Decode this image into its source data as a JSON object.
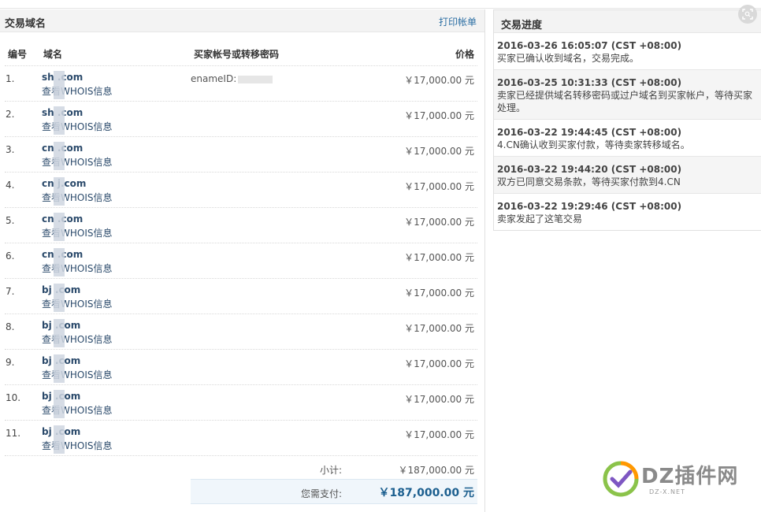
{
  "domains_panel": {
    "title": "交易域名",
    "print_label": "打印帐单",
    "headers": {
      "no": "编号",
      "domain": "域名",
      "code": "买家帐号或转移密码",
      "price": "价格"
    },
    "rows": [
      {
        "no": "1.",
        "domain": "sh   .com",
        "whois": "查看WHOIS信息",
        "code": "enameID:",
        "price": "￥17,000.00 元"
      },
      {
        "no": "2.",
        "domain": "sh   .com",
        "whois": "查看WHOIS信息",
        "code": "",
        "price": "￥17,000.00 元"
      },
      {
        "no": "3.",
        "domain": "cn   .com",
        "whois": "查看WHOIS信息",
        "code": "",
        "price": "￥17,000.00 元"
      },
      {
        "no": "4.",
        "domain": "cn   j.com",
        "whois": "查看WHOIS信息",
        "code": "",
        "price": "￥17,000.00 元"
      },
      {
        "no": "5.",
        "domain": "cn   .com",
        "whois": "查看WHOIS信息",
        "code": "",
        "price": "￥17,000.00 元"
      },
      {
        "no": "6.",
        "domain": "cn   .com",
        "whois": "查看WHOIS信息",
        "code": "",
        "price": "￥17,000.00 元"
      },
      {
        "no": "7.",
        "domain": "bj   .com",
        "whois": "查看WHOIS信息",
        "code": "",
        "price": "￥17,000.00 元"
      },
      {
        "no": "8.",
        "domain": "bj   .com",
        "whois": "查看WHOIS信息",
        "code": "",
        "price": "￥17,000.00 元"
      },
      {
        "no": "9.",
        "domain": "bj   .com",
        "whois": "查看WHOIS信息",
        "code": "",
        "price": "￥17,000.00 元"
      },
      {
        "no": "10.",
        "domain": "bj   .com",
        "whois": "查看WHOIS信息",
        "code": "",
        "price": "￥17,000.00 元"
      },
      {
        "no": "11.",
        "domain": "bj   .com",
        "whois": "查看WHOIS信息",
        "code": "",
        "price": "￥17,000.00 元"
      }
    ],
    "subtotal_label": "小计:",
    "subtotal_value": "￥187,000.00 元",
    "pay_label": "您需支付:",
    "pay_value": "￥187,000.00 元"
  },
  "progress_panel": {
    "title": "交易进度",
    "events": [
      {
        "time": "2016-03-26 16:05:07 (CST +08:00)",
        "text": "买家已确认收到域名，交易完成。"
      },
      {
        "time": "2016-03-25 10:31:33 (CST +08:00)",
        "text": "卖家已经提供域名转移密码或过户域名到买家帐户，等待买家处理。"
      },
      {
        "time": "2016-03-22 19:44:45 (CST +08:00)",
        "text": "4.CN确认收到买家付款，等待卖家转移域名。"
      },
      {
        "time": "2016-03-22 19:44:20 (CST +08:00)",
        "text": "双方已同意交易条款，等待买家付款到4.CN"
      },
      {
        "time": "2016-03-22 19:29:46 (CST +08:00)",
        "text": "卖家发起了这笔交易"
      }
    ]
  },
  "watermark": {
    "name": "DZ插件网",
    "url": "DZ-X.NET"
  },
  "icons": {
    "zoom": "zoom-fit-icon",
    "logo": "dz-logo-icon"
  },
  "colors": {
    "link": "#2b6ea3",
    "domain_text": "#2b4a6b",
    "pay_total": "#1c5f8f"
  }
}
